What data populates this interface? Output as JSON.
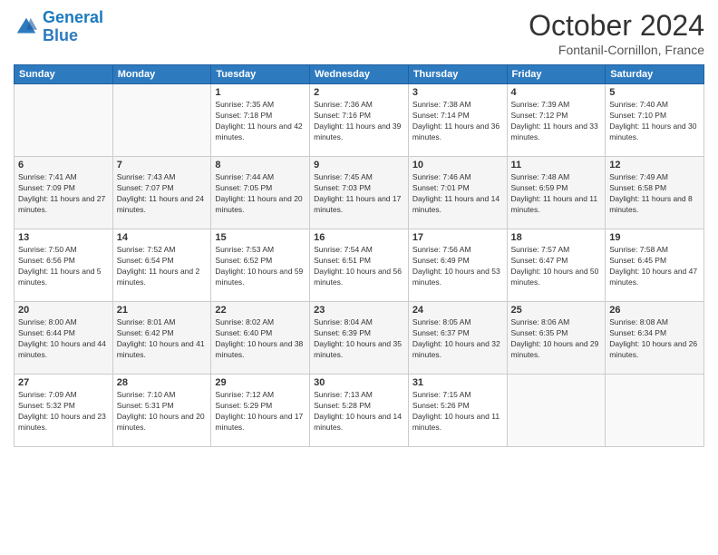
{
  "header": {
    "logo_general": "General",
    "logo_blue": "Blue",
    "month": "October 2024",
    "location": "Fontanil-Cornillon, France"
  },
  "days_of_week": [
    "Sunday",
    "Monday",
    "Tuesday",
    "Wednesday",
    "Thursday",
    "Friday",
    "Saturday"
  ],
  "weeks": [
    [
      {
        "day": "",
        "info": ""
      },
      {
        "day": "",
        "info": ""
      },
      {
        "day": "1",
        "info": "Sunrise: 7:35 AM\nSunset: 7:18 PM\nDaylight: 11 hours and 42 minutes."
      },
      {
        "day": "2",
        "info": "Sunrise: 7:36 AM\nSunset: 7:16 PM\nDaylight: 11 hours and 39 minutes."
      },
      {
        "day": "3",
        "info": "Sunrise: 7:38 AM\nSunset: 7:14 PM\nDaylight: 11 hours and 36 minutes."
      },
      {
        "day": "4",
        "info": "Sunrise: 7:39 AM\nSunset: 7:12 PM\nDaylight: 11 hours and 33 minutes."
      },
      {
        "day": "5",
        "info": "Sunrise: 7:40 AM\nSunset: 7:10 PM\nDaylight: 11 hours and 30 minutes."
      }
    ],
    [
      {
        "day": "6",
        "info": "Sunrise: 7:41 AM\nSunset: 7:09 PM\nDaylight: 11 hours and 27 minutes."
      },
      {
        "day": "7",
        "info": "Sunrise: 7:43 AM\nSunset: 7:07 PM\nDaylight: 11 hours and 24 minutes."
      },
      {
        "day": "8",
        "info": "Sunrise: 7:44 AM\nSunset: 7:05 PM\nDaylight: 11 hours and 20 minutes."
      },
      {
        "day": "9",
        "info": "Sunrise: 7:45 AM\nSunset: 7:03 PM\nDaylight: 11 hours and 17 minutes."
      },
      {
        "day": "10",
        "info": "Sunrise: 7:46 AM\nSunset: 7:01 PM\nDaylight: 11 hours and 14 minutes."
      },
      {
        "day": "11",
        "info": "Sunrise: 7:48 AM\nSunset: 6:59 PM\nDaylight: 11 hours and 11 minutes."
      },
      {
        "day": "12",
        "info": "Sunrise: 7:49 AM\nSunset: 6:58 PM\nDaylight: 11 hours and 8 minutes."
      }
    ],
    [
      {
        "day": "13",
        "info": "Sunrise: 7:50 AM\nSunset: 6:56 PM\nDaylight: 11 hours and 5 minutes."
      },
      {
        "day": "14",
        "info": "Sunrise: 7:52 AM\nSunset: 6:54 PM\nDaylight: 11 hours and 2 minutes."
      },
      {
        "day": "15",
        "info": "Sunrise: 7:53 AM\nSunset: 6:52 PM\nDaylight: 10 hours and 59 minutes."
      },
      {
        "day": "16",
        "info": "Sunrise: 7:54 AM\nSunset: 6:51 PM\nDaylight: 10 hours and 56 minutes."
      },
      {
        "day": "17",
        "info": "Sunrise: 7:56 AM\nSunset: 6:49 PM\nDaylight: 10 hours and 53 minutes."
      },
      {
        "day": "18",
        "info": "Sunrise: 7:57 AM\nSunset: 6:47 PM\nDaylight: 10 hours and 50 minutes."
      },
      {
        "day": "19",
        "info": "Sunrise: 7:58 AM\nSunset: 6:45 PM\nDaylight: 10 hours and 47 minutes."
      }
    ],
    [
      {
        "day": "20",
        "info": "Sunrise: 8:00 AM\nSunset: 6:44 PM\nDaylight: 10 hours and 44 minutes."
      },
      {
        "day": "21",
        "info": "Sunrise: 8:01 AM\nSunset: 6:42 PM\nDaylight: 10 hours and 41 minutes."
      },
      {
        "day": "22",
        "info": "Sunrise: 8:02 AM\nSunset: 6:40 PM\nDaylight: 10 hours and 38 minutes."
      },
      {
        "day": "23",
        "info": "Sunrise: 8:04 AM\nSunset: 6:39 PM\nDaylight: 10 hours and 35 minutes."
      },
      {
        "day": "24",
        "info": "Sunrise: 8:05 AM\nSunset: 6:37 PM\nDaylight: 10 hours and 32 minutes."
      },
      {
        "day": "25",
        "info": "Sunrise: 8:06 AM\nSunset: 6:35 PM\nDaylight: 10 hours and 29 minutes."
      },
      {
        "day": "26",
        "info": "Sunrise: 8:08 AM\nSunset: 6:34 PM\nDaylight: 10 hours and 26 minutes."
      }
    ],
    [
      {
        "day": "27",
        "info": "Sunrise: 7:09 AM\nSunset: 5:32 PM\nDaylight: 10 hours and 23 minutes."
      },
      {
        "day": "28",
        "info": "Sunrise: 7:10 AM\nSunset: 5:31 PM\nDaylight: 10 hours and 20 minutes."
      },
      {
        "day": "29",
        "info": "Sunrise: 7:12 AM\nSunset: 5:29 PM\nDaylight: 10 hours and 17 minutes."
      },
      {
        "day": "30",
        "info": "Sunrise: 7:13 AM\nSunset: 5:28 PM\nDaylight: 10 hours and 14 minutes."
      },
      {
        "day": "31",
        "info": "Sunrise: 7:15 AM\nSunset: 5:26 PM\nDaylight: 10 hours and 11 minutes."
      },
      {
        "day": "",
        "info": ""
      },
      {
        "day": "",
        "info": ""
      }
    ]
  ]
}
